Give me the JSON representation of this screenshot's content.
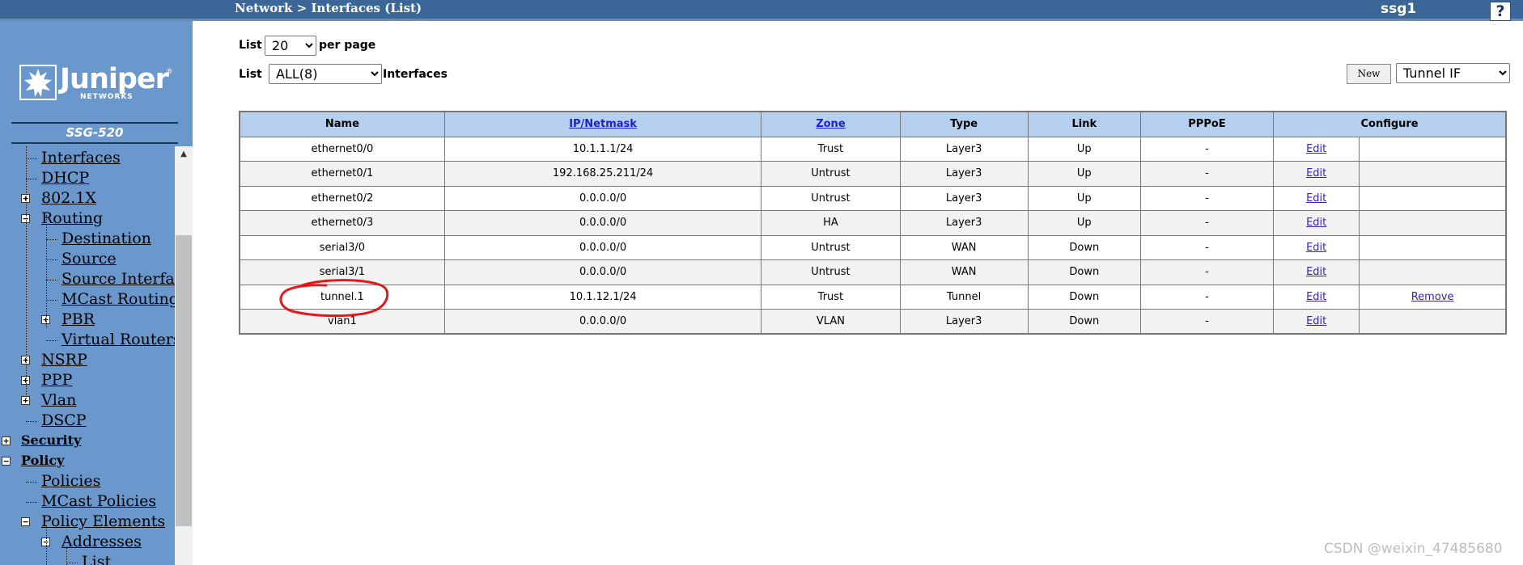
{
  "header": {
    "breadcrumb": "Network > Interfaces (List)",
    "device_name": "ssg1",
    "help_label": "?"
  },
  "brand": {
    "logo_text": "Juniper",
    "logo_registered": "®",
    "logo_subtext": "NETWORKS",
    "model": "SSG-520"
  },
  "sidebar": {
    "items": [
      {
        "label": "Interfaces",
        "level": 2,
        "expander": ""
      },
      {
        "label": "DHCP",
        "level": 2,
        "expander": ""
      },
      {
        "label": "802.1X",
        "level": 2,
        "expander": "+"
      },
      {
        "label": "Routing",
        "level": 2,
        "expander": "−"
      },
      {
        "label": "Destination",
        "level": 3,
        "expander": ""
      },
      {
        "label": "Source",
        "level": 3,
        "expander": ""
      },
      {
        "label": "Source Interface",
        "level": 3,
        "expander": ""
      },
      {
        "label": "MCast Routing",
        "level": 3,
        "expander": ""
      },
      {
        "label": "PBR",
        "level": 3,
        "expander": "+"
      },
      {
        "label": "Virtual Routers",
        "level": 3,
        "expander": ""
      },
      {
        "label": "NSRP",
        "level": 2,
        "expander": "+"
      },
      {
        "label": "PPP",
        "level": 2,
        "expander": "+"
      },
      {
        "label": "Vlan",
        "level": 2,
        "expander": "+"
      },
      {
        "label": "DSCP",
        "level": 2,
        "expander": ""
      },
      {
        "label": "Security",
        "level": 1,
        "expander": "+"
      },
      {
        "label": "Policy",
        "level": 1,
        "expander": "−"
      },
      {
        "label": "Policies",
        "level": 2,
        "expander": ""
      },
      {
        "label": "MCast Policies",
        "level": 2,
        "expander": ""
      },
      {
        "label": "Policy Elements",
        "level": 2,
        "expander": "−"
      },
      {
        "label": "Addresses",
        "level": 3,
        "expander": "−"
      },
      {
        "label": "List",
        "level": 4,
        "expander": ""
      }
    ]
  },
  "controls": {
    "list_label_1": "List",
    "per_page_value": "20",
    "per_page_suffix": "per page",
    "list_label_2": "List",
    "filter_value": "ALL(8)",
    "filter_suffix": "Interfaces",
    "new_button": "New",
    "type_select_value": "Tunnel IF"
  },
  "table": {
    "headers": [
      "Name",
      "IP/Netmask",
      "Zone",
      "Type",
      "Link",
      "PPPoE",
      "Configure"
    ],
    "rows": [
      {
        "name": "ethernet0/0",
        "ip": "10.1.1.1/24",
        "zone": "Trust",
        "type": "Layer3",
        "link": "Up",
        "pppoe": "-",
        "edit": "Edit",
        "remove": ""
      },
      {
        "name": "ethernet0/1",
        "ip": "192.168.25.211/24",
        "zone": "Untrust",
        "type": "Layer3",
        "link": "Up",
        "pppoe": "-",
        "edit": "Edit",
        "remove": ""
      },
      {
        "name": "ethernet0/2",
        "ip": "0.0.0.0/0",
        "zone": "Untrust",
        "type": "Layer3",
        "link": "Up",
        "pppoe": "-",
        "edit": "Edit",
        "remove": ""
      },
      {
        "name": "ethernet0/3",
        "ip": "0.0.0.0/0",
        "zone": "HA",
        "type": "Layer3",
        "link": "Up",
        "pppoe": "-",
        "edit": "Edit",
        "remove": ""
      },
      {
        "name": "serial3/0",
        "ip": "0.0.0.0/0",
        "zone": "Untrust",
        "type": "WAN",
        "link": "Down",
        "pppoe": "-",
        "edit": "Edit",
        "remove": ""
      },
      {
        "name": "serial3/1",
        "ip": "0.0.0.0/0",
        "zone": "Untrust",
        "type": "WAN",
        "link": "Down",
        "pppoe": "-",
        "edit": "Edit",
        "remove": ""
      },
      {
        "name": "tunnel.1",
        "ip": "10.1.12.1/24",
        "zone": "Trust",
        "type": "Tunnel",
        "link": "Down",
        "pppoe": "-",
        "edit": "Edit",
        "remove": "Remove"
      },
      {
        "name": "vlan1",
        "ip": "0.0.0.0/0",
        "zone": "VLAN",
        "type": "Layer3",
        "link": "Down",
        "pppoe": "-",
        "edit": "Edit",
        "remove": ""
      }
    ]
  },
  "watermark": "CSDN @weixin_47485680",
  "colors": {
    "header_bar": "#3a6797",
    "sidebar": "#6a98cd",
    "table_header": "#b4d0ee",
    "annotation": "#e0191d"
  }
}
